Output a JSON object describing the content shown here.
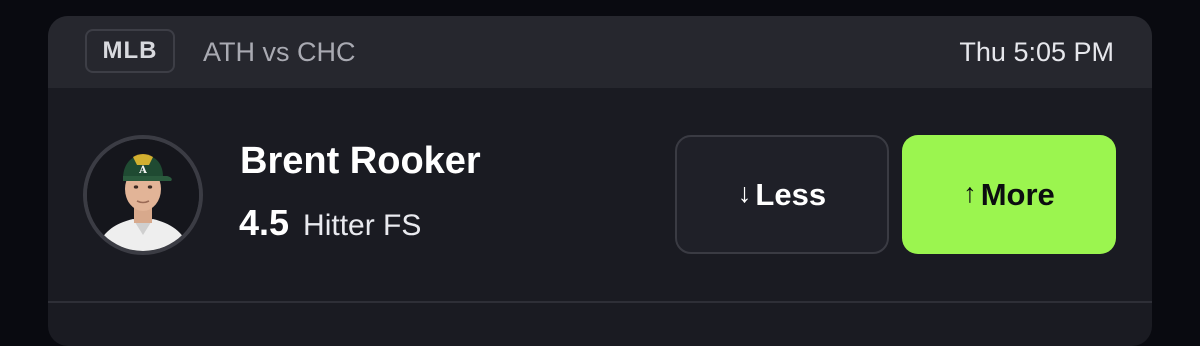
{
  "header": {
    "league": "MLB",
    "matchup": "ATH vs CHC",
    "game_time": "Thu 5:05 PM"
  },
  "player": {
    "name": "Brent Rooker",
    "line_value": "4.5",
    "stat_type": "Hitter FS",
    "avatar_icon": "player-headshot"
  },
  "actions": {
    "less_label": "Less",
    "less_icon": "arrow-down-icon",
    "more_label": "More",
    "more_icon": "arrow-up-icon"
  },
  "colors": {
    "page_background": "#090a10",
    "card_background": "#1a1b22",
    "header_background": "#26272e",
    "more_accent": "#9bf54f"
  }
}
